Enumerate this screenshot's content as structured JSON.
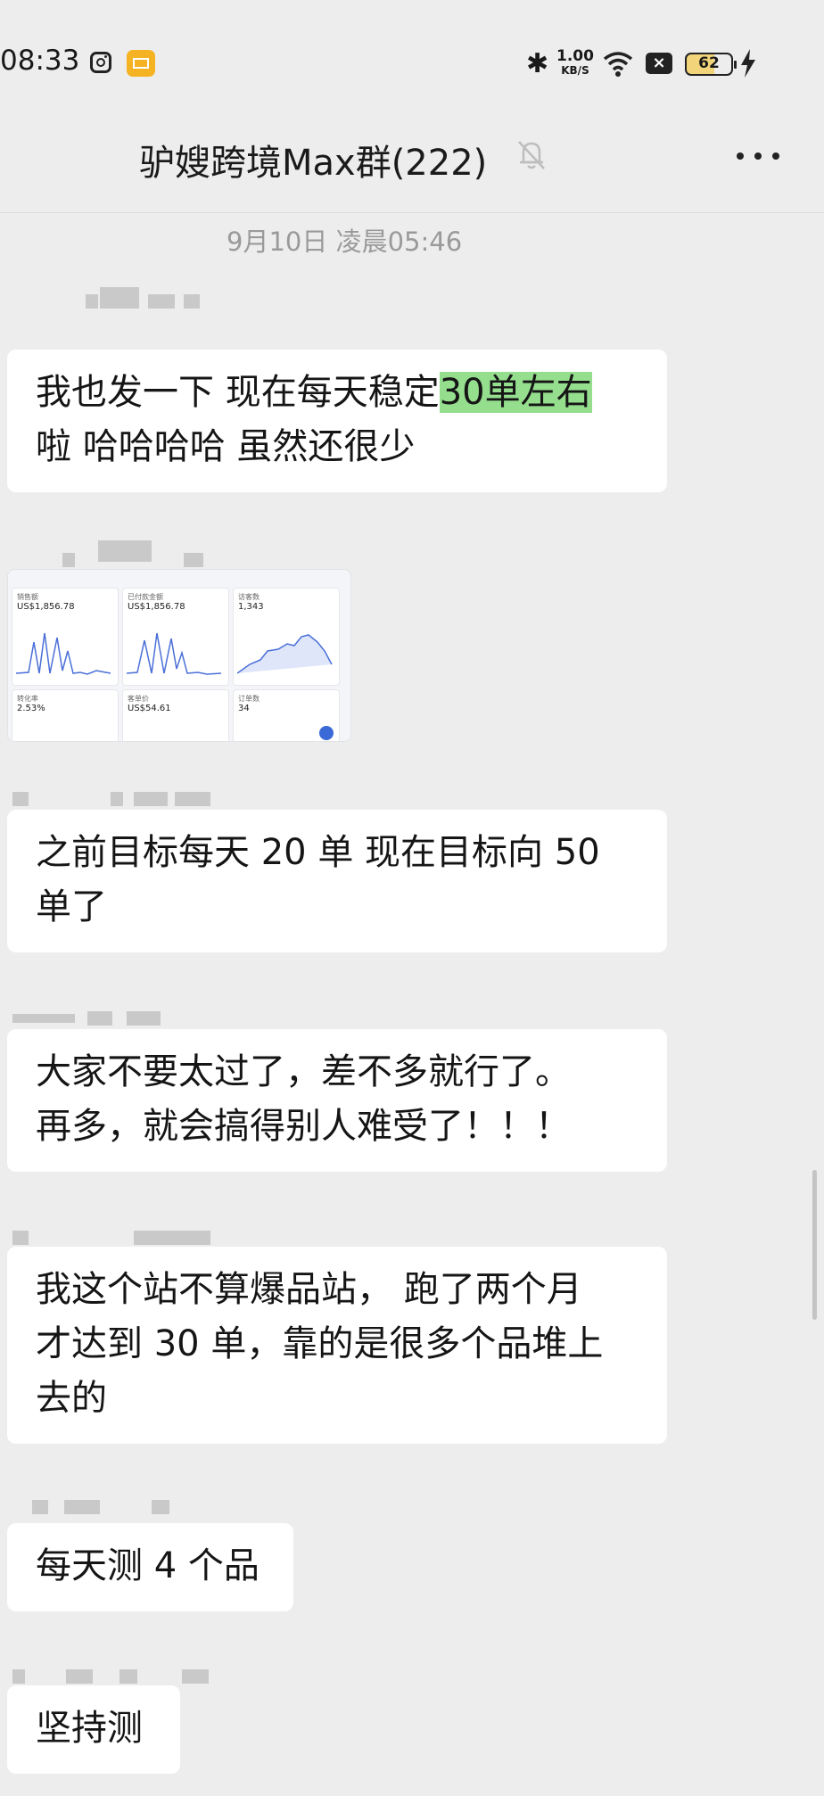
{
  "status_bar": {
    "time": "08:33",
    "network_speed_value": "1.00",
    "network_speed_unit": "KB/S",
    "battery_level": "62",
    "icons": [
      "instagram-icon",
      "mail-icon",
      "bluetooth-icon",
      "wifi-icon",
      "x-icon",
      "battery-icon",
      "charging-icon"
    ]
  },
  "nav": {
    "title": "驴嫂跨境Max群(222)",
    "mute_icon": "bell-off-icon",
    "more_icon": "more-icon"
  },
  "chat": {
    "timestamp": "9月10日 凌晨05:46",
    "messages": [
      {
        "type": "text",
        "line1_prefix": "我也发一下 现在每天稳定",
        "line1_highlight": "30单左右",
        "line2": "啦 哈哈哈哈 虽然还很少"
      },
      {
        "type": "image",
        "tiles": [
          {
            "label": "销售额",
            "value": "US$1,856.78"
          },
          {
            "label": "已付款金额",
            "value": "US$1,856.78"
          },
          {
            "label": "访客数",
            "value": "1,343"
          },
          {
            "label": "转化率",
            "value": "2.53%"
          },
          {
            "label": "客单价",
            "value": "US$54.61"
          },
          {
            "label": "订单数",
            "value": "34"
          }
        ]
      },
      {
        "type": "text",
        "line1": "之前目标每天 20 单 现在目标向 50",
        "line2": "单了"
      },
      {
        "type": "text",
        "line1": "大家不要太过了，差不多就行了。",
        "line2": "再多，就会搞得别人难受了！！！"
      },
      {
        "type": "text",
        "line1": "我这个站不算爆品站， 跑了两个月",
        "line2": "才达到 30 单，靠的是很多个品堆上",
        "line3": "去的"
      },
      {
        "type": "text",
        "line1": "每天测 4 个品"
      },
      {
        "type": "text",
        "line1": "坚持测"
      }
    ]
  }
}
